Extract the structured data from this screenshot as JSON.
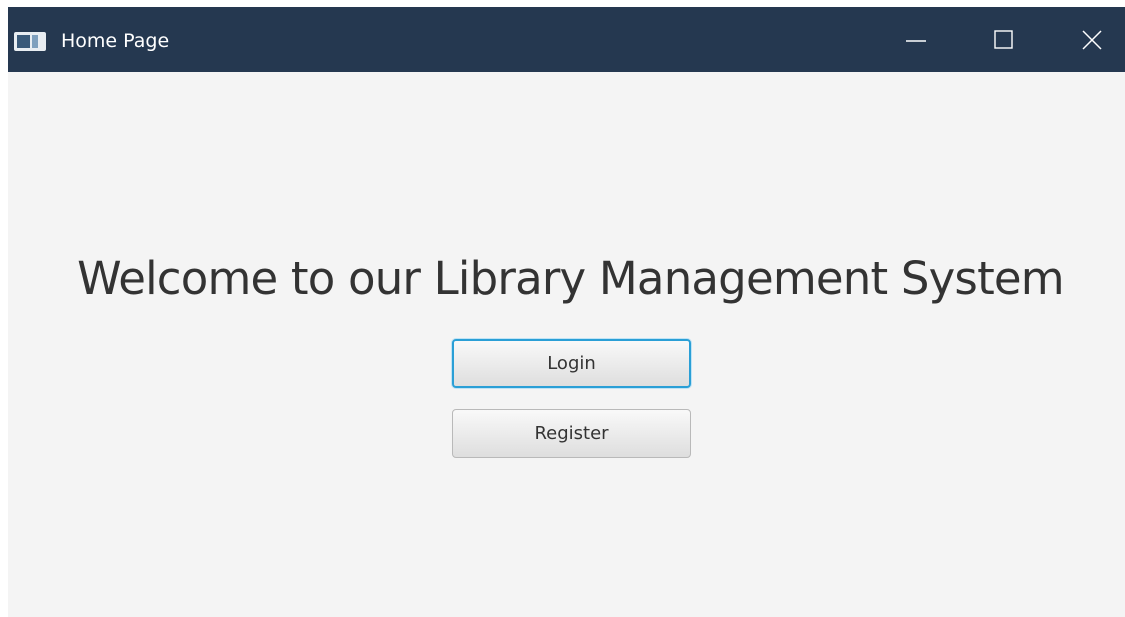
{
  "window": {
    "title": "Home Page",
    "icons": {
      "app": "app-window-icon",
      "minimize": "minimize-icon",
      "maximize": "maximize-icon",
      "close": "close-icon"
    },
    "colors": {
      "titlebar": "#253850",
      "background": "#f4f4f4",
      "focus_ring": "#2a9fd6"
    }
  },
  "main": {
    "heading": "Welcome to our Library Management System",
    "login_label": "Login",
    "register_label": "Register"
  }
}
